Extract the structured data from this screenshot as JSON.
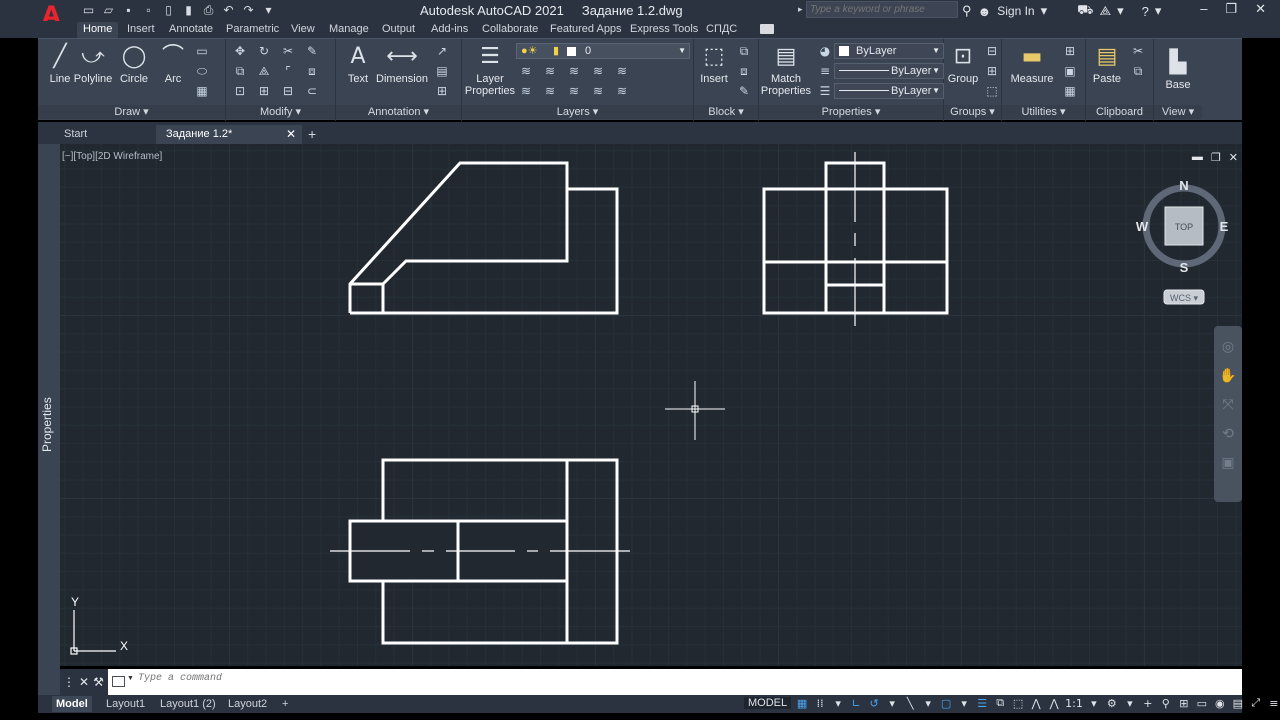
{
  "app": {
    "logo": "A",
    "title": "Autodesk AutoCAD 2021     Задание 1.2.dwg"
  },
  "search": {
    "placeholder": "Type a keyword or phrase"
  },
  "signin": "Sign In",
  "ribbon_tabs": [
    "Home",
    "Insert",
    "Annotate",
    "Parametric",
    "View",
    "Manage",
    "Output",
    "Add-ins",
    "Collaborate",
    "Featured Apps",
    "Express Tools",
    "СПДС"
  ],
  "draw": {
    "line": "Line",
    "polyline": "Polyline",
    "circle": "Circle",
    "arc": "Arc",
    "title": "Draw ▾"
  },
  "modify": {
    "title": "Modify ▾"
  },
  "annotation": {
    "text": "Text",
    "dimension": "Dimension",
    "title": "Annotation ▾"
  },
  "layers": {
    "layer_properties_1": "Layer",
    "layer_properties_2": "Properties",
    "current_layer": "0",
    "title": "Layers ▾"
  },
  "block": {
    "insert": "Insert",
    "title": "Block ▾"
  },
  "properties": {
    "match_1": "Match",
    "match_2": "Properties",
    "color": "ByLayer",
    "linetype": "ByLayer",
    "lineweight": "ByLayer",
    "title": "Properties ▾"
  },
  "groups": {
    "group": "Group",
    "title": "Groups ▾"
  },
  "utilities": {
    "measure": "Measure",
    "title": "Utilities ▾"
  },
  "clipboard": {
    "paste": "Paste",
    "title": "Clipboard"
  },
  "view": {
    "base": "Base",
    "title": "View ▾"
  },
  "doc_tabs": {
    "start": "Start",
    "active": "Задание 1.2*"
  },
  "properties_palette": "Properties",
  "viewport": {
    "controls": "[−][Top][2D Wireframe]"
  },
  "viewcube": {
    "n": "N",
    "s": "S",
    "e": "E",
    "w": "W",
    "top": "TOP",
    "wcs": "WCS ▾"
  },
  "ucs": {
    "x": "X",
    "y": "Y"
  },
  "command": {
    "placeholder": "Type a command"
  },
  "layout_tabs": [
    "Model",
    "Layout1",
    "Layout1 (2)",
    "Layout2"
  ],
  "status": {
    "model": "MODEL",
    "scale": "1:1"
  },
  "colors": {
    "accent": "#4aa4f0",
    "logo": "#e8242e",
    "canvas": "#212830"
  }
}
